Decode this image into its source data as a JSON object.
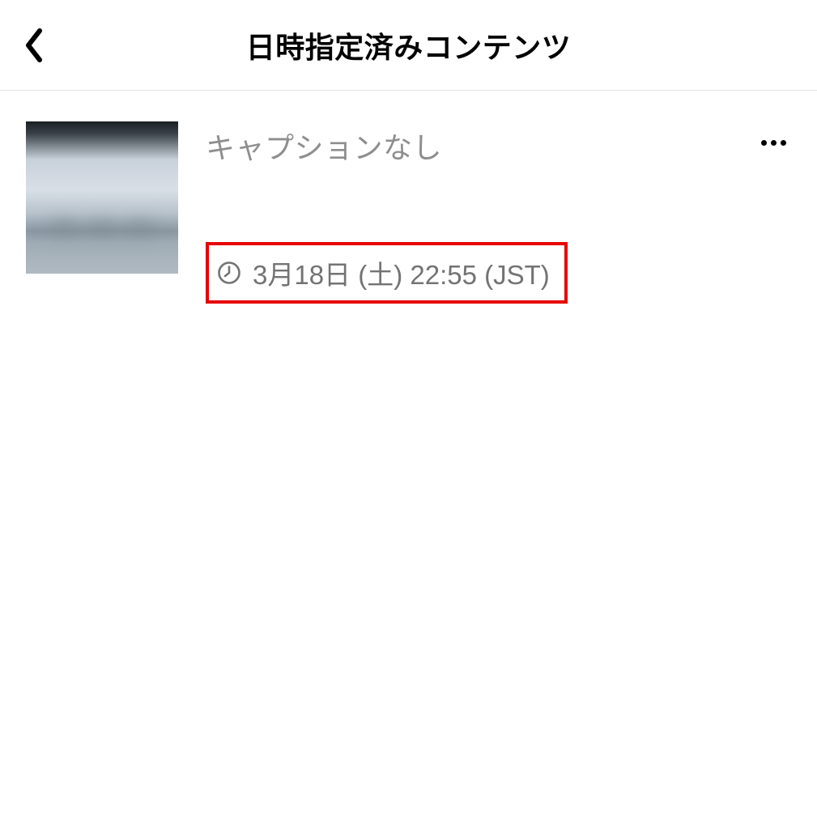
{
  "header": {
    "title": "日時指定済みコンテンツ"
  },
  "content": {
    "items": [
      {
        "caption": "キャプションなし",
        "scheduled_date": "3月18日 (土) 22:55 (JST)"
      }
    ]
  },
  "icons": {
    "back": "back-chevron-icon",
    "clock": "clock-icon",
    "more": "more-dots-icon"
  },
  "colors": {
    "highlight_box": "#e60000",
    "secondary_text": "#8e8e8e",
    "date_text": "#737373"
  }
}
